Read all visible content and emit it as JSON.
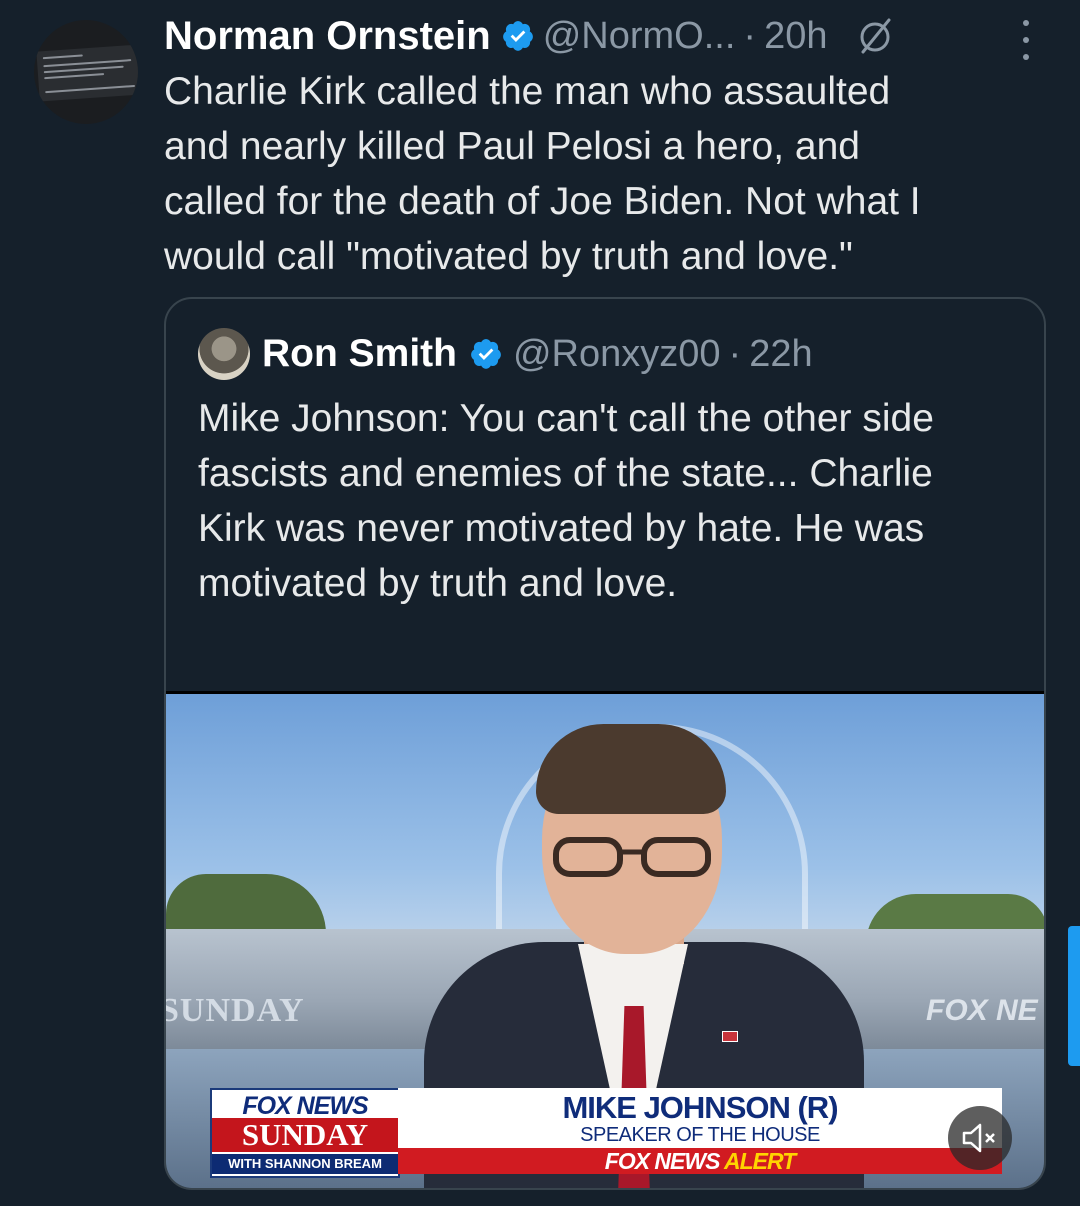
{
  "tweet": {
    "author_name": "Norman Ornstein",
    "handle": "@NormO...",
    "separator": "·",
    "time": "20h",
    "text": "Charlie Kirk called the man who assaulted\nand nearly killed Paul Pelosi a hero, and\ncalled for the death of Joe Biden. Not what I\nwould call \"motivated by truth and love.\""
  },
  "quote": {
    "author_name": "Ron Smith",
    "handle": "@Ronxyz00",
    "separator": "·",
    "time": "22h",
    "text": "Mike Johnson: You can't call the other side\nfascists and enemies of the state... Charlie\nKirk was never motivated by hate. He was\nmotivated by truth and love.",
    "ellipsis": "..."
  },
  "video": {
    "bg_sunday": "SUNDAY",
    "bg_foxnews": "FOX NE",
    "logo_top": "FOX NEWS",
    "logo_show": "SUNDAY",
    "logo_host": "WITH SHANNON BREAM",
    "chyron_name": "MIKE JOHNSON (R)",
    "chyron_title": "SPEAKER OF THE HOUSE",
    "alert_brand": "FOX NEWS",
    "alert_word": "ALERT"
  },
  "icons": {
    "verified": "verified-badge-icon",
    "grok": "grok-icon",
    "more": "more-options-icon",
    "mute": "mute-icon"
  },
  "colors": {
    "background": "#15202b",
    "accent": "#1d9bf0",
    "muted_text": "#8b98a5",
    "border": "#38444d"
  }
}
